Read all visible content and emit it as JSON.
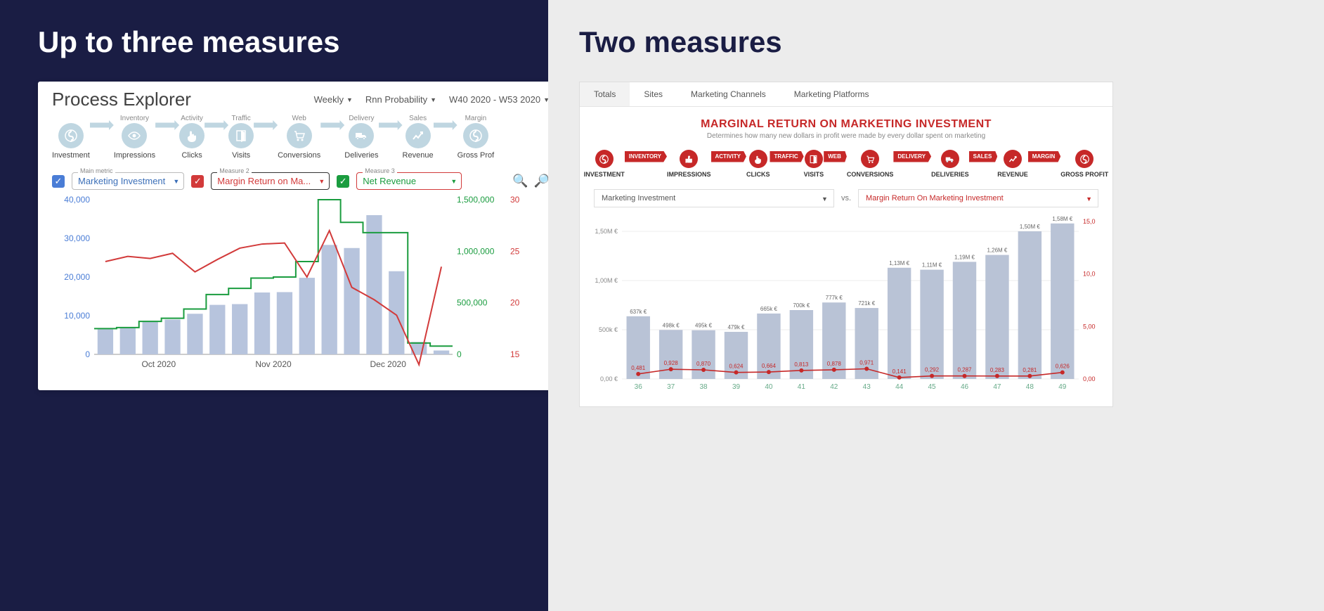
{
  "left": {
    "title_text": "Up to three measures",
    "card_title": "Process Explorer",
    "dropdowns": {
      "interval": "Weekly",
      "model": "Rnn Probability",
      "period": "W40 2020 - W53 2020"
    },
    "flow": [
      {
        "top": "",
        "name": "Investment",
        "icon": "dollar"
      },
      {
        "top": "Inventory",
        "name": "Impressions",
        "icon": "eye"
      },
      {
        "top": "Activity",
        "name": "Clicks",
        "icon": "hand"
      },
      {
        "top": "Traffic",
        "name": "Visits",
        "icon": "door"
      },
      {
        "top": "Web",
        "name": "Conversions",
        "icon": "cart"
      },
      {
        "top": "Delivery",
        "name": "Deliveries",
        "icon": "truck"
      },
      {
        "top": "Sales",
        "name": "Revenue",
        "icon": "trend"
      },
      {
        "top": "Margin",
        "name": "Gross Prof",
        "icon": "dollar"
      }
    ],
    "measures": {
      "main_label": "Main metric",
      "main_value": "Marketing Investment",
      "m2_label": "Measure 2",
      "m2_value": "Margin Return on Ma...",
      "m3_label": "Measure 3",
      "m3_value": "Net Revenue"
    }
  },
  "right": {
    "title_text": "Two measures",
    "tabs": [
      "Totals",
      "Sites",
      "Marketing Channels",
      "Marketing Platforms"
    ],
    "active_tab": 0,
    "headline": "MARGINAL RETURN ON MARKETING INVESTMENT",
    "sub": "Determines how many new dollars in profit were made by every dollar spent on marketing",
    "flow": [
      {
        "bar": "INVENTORY",
        "name": "INVESTMENT",
        "icon": "dollar"
      },
      {
        "bar": "ACTIVITY",
        "name": "IMPRESSIONS",
        "icon": "thumb"
      },
      {
        "bar": "TRAFFIC",
        "name": "CLICKS",
        "icon": "hand"
      },
      {
        "bar": "WEB",
        "name": "VISITS",
        "icon": "door"
      },
      {
        "bar": "DELIVERY",
        "name": "CONVERSIONS",
        "icon": "cart"
      },
      {
        "bar": "SALES",
        "name": "DELIVERIES",
        "icon": "truck"
      },
      {
        "bar": "MARGIN",
        "name": "REVENUE",
        "icon": "trend"
      },
      {
        "bar": "",
        "name": "GROSS PROFIT",
        "icon": "dollar"
      }
    ],
    "select_left": "Marketing Investment",
    "vs": "vs.",
    "select_right": "Margin Return On Marketing Investment"
  },
  "chart_data": [
    {
      "id": "process_explorer_chart",
      "type": "bar+line+step",
      "x_ticks": [
        "Oct 2020",
        "Nov 2020",
        "Dec 2020"
      ],
      "series": [
        {
          "name": "Marketing Investment",
          "role": "bar",
          "axis": "y_left",
          "values": [
            6500,
            6800,
            8500,
            9000,
            10500,
            12800,
            13000,
            16000,
            16100,
            19800,
            28300,
            27500,
            36000,
            21500,
            3200,
            1000
          ]
        },
        {
          "name": "Net Revenue",
          "role": "step",
          "axis": "y_right_inner",
          "color": "#1a9c3f",
          "values": [
            250000,
            260000,
            320000,
            350000,
            440000,
            580000,
            640000,
            740000,
            750000,
            900000,
            1500000,
            1280000,
            1180000,
            1180000,
            110000,
            80000
          ]
        },
        {
          "name": "Margin Return on Marketing",
          "role": "line",
          "axis": "y_right_outer",
          "color": "#d23a3a",
          "values": [
            24.0,
            24.5,
            24.3,
            24.8,
            23.0,
            24.2,
            25.3,
            25.7,
            25.8,
            22.5,
            27.0,
            21.5,
            20.3,
            18.8,
            14.0,
            23.5
          ]
        }
      ],
      "y_left": {
        "min": 0,
        "max": 40000,
        "ticks": [
          0,
          10000,
          20000,
          30000,
          40000
        ],
        "labels": [
          "0",
          "10,000",
          "20,000",
          "30,000",
          "40,000"
        ]
      },
      "y_right_inner": {
        "min": 0,
        "max": 1500000,
        "ticks": [
          0,
          500000,
          1000000,
          1500000
        ],
        "labels": [
          "0",
          "500,000",
          "1,000,000",
          "1,500,000"
        ]
      },
      "y_right_outer": {
        "min": 15,
        "max": 30,
        "ticks": [
          15,
          20,
          25,
          30
        ]
      }
    },
    {
      "id": "mromi_chart",
      "type": "bar+line",
      "categories": [
        "36",
        "37",
        "38",
        "39",
        "40",
        "41",
        "42",
        "43",
        "44",
        "45",
        "46",
        "47",
        "48",
        "49"
      ],
      "series": [
        {
          "name": "Marketing Investment",
          "role": "bar",
          "unit": "€",
          "axis": "y_left",
          "values": [
            637000,
            498000,
            495000,
            479000,
            665000,
            700000,
            777000,
            721000,
            1130000,
            1110000,
            1190000,
            1260000,
            1500000,
            1580000
          ],
          "value_labels": [
            "637k €",
            "498k €",
            "495k €",
            "479k €",
            "665k €",
            "700k €",
            "777k €",
            "721k €",
            "1,13M €",
            "1,11M €",
            "1,19M €",
            "1,26M €",
            "1,50M €",
            "1,58M €"
          ]
        },
        {
          "name": "Margin Return On Marketing Investment",
          "role": "line",
          "axis": "y_right",
          "color": "#c62828",
          "values": [
            0.481,
            0.928,
            0.87,
            0.624,
            0.664,
            0.813,
            0.878,
            0.971,
            0.141,
            0.292,
            0.287,
            0.283,
            0.281,
            0.626
          ],
          "value_labels": [
            "0,481",
            "0,928",
            "0,870",
            "0,624",
            "0,664",
            "0,813",
            "0,878",
            "0,971",
            "0,141",
            "0,292",
            "0,287",
            "0,283",
            "0,281",
            "0,626"
          ]
        }
      ],
      "y_left": {
        "min": 0,
        "max": 1600000,
        "ticks": [
          0,
          500000,
          1000000,
          1500000
        ],
        "labels": [
          "0,00 €",
          "500k €",
          "1,00M €",
          "1,50M €"
        ]
      },
      "y_right": {
        "min": 0,
        "max": 15,
        "ticks": [
          0,
          5,
          10,
          15
        ],
        "labels": [
          "0,00",
          "5,00",
          "10,0",
          "15,0"
        ]
      }
    }
  ]
}
